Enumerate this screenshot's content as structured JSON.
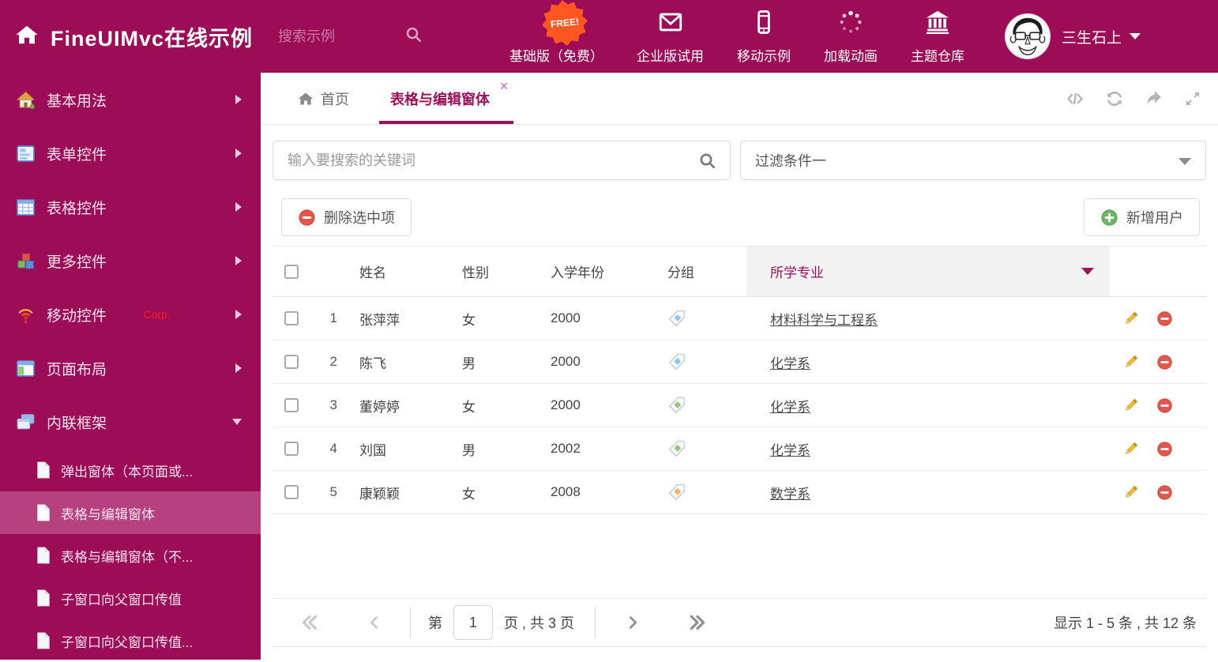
{
  "colors": {
    "accent": "#9D0C57",
    "tab_accent": "#9B1159",
    "free_badge": "#FF5722",
    "delete_red": "#E2574C",
    "add_green": "#6CB564",
    "pencil_gold": "#EDB72B",
    "tags": {
      "blue": "#8EC7F1",
      "green": "#94C77D",
      "orange": "#F8B26A"
    }
  },
  "header": {
    "title": "FineUIMvc在线示例",
    "search_placeholder": "搜索示例",
    "free_badge": "FREE!",
    "nav": [
      {
        "label": "基础版（免费）",
        "icon": "download-icon"
      },
      {
        "label": "企业版试用",
        "icon": "envelope-icon"
      },
      {
        "label": "移动示例",
        "icon": "mobile-icon"
      },
      {
        "label": "加载动画",
        "icon": "spinner-icon"
      },
      {
        "label": "主题仓库",
        "icon": "bank-icon"
      }
    ],
    "username": "三生石上"
  },
  "sidebar": {
    "items": [
      {
        "label": "基本用法"
      },
      {
        "label": "表单控件"
      },
      {
        "label": "表格控件"
      },
      {
        "label": "更多控件"
      },
      {
        "label": "移动控件",
        "badge": "Corp."
      },
      {
        "label": "页面布局"
      },
      {
        "label": "内联框架",
        "expanded": true
      }
    ],
    "subitems": [
      {
        "label": "弹出窗体（本页面或..."
      },
      {
        "label": "表格与编辑窗体",
        "active": true
      },
      {
        "label": "表格与编辑窗体（不..."
      },
      {
        "label": "子窗口向父窗口传值"
      },
      {
        "label": "子窗口向父窗口传值..."
      }
    ]
  },
  "tabs": [
    {
      "label": "首页"
    },
    {
      "label": "表格与编辑窗体",
      "active": true,
      "closable": true
    }
  ],
  "filters": {
    "search_placeholder": "输入要搜索的关键词",
    "filter_value": "过滤条件一"
  },
  "grid": {
    "delete_button": "删除选中项",
    "add_button": "新增用户",
    "columns": [
      "姓名",
      "性别",
      "入学年份",
      "分组",
      "所学专业"
    ],
    "rows": [
      {
        "num": "1",
        "name": "张萍萍",
        "gender": "女",
        "year": "2000",
        "tag": "blue",
        "major": "材料科学与工程系"
      },
      {
        "num": "2",
        "name": "陈飞",
        "gender": "男",
        "year": "2000",
        "tag": "blue",
        "major": "化学系"
      },
      {
        "num": "3",
        "name": "董婷婷",
        "gender": "女",
        "year": "2000",
        "tag": "green",
        "major": "化学系"
      },
      {
        "num": "4",
        "name": "刘国",
        "gender": "男",
        "year": "2002",
        "tag": "green",
        "major": "化学系"
      },
      {
        "num": "5",
        "name": "康颖颖",
        "gender": "女",
        "year": "2008",
        "tag": "orange",
        "major": "数学系"
      }
    ]
  },
  "pagination": {
    "page_prefix": "第",
    "page_value": "1",
    "page_suffix": "页 , 共 3 页",
    "summary": "显示 1 - 5 条 , 共 12 条"
  }
}
